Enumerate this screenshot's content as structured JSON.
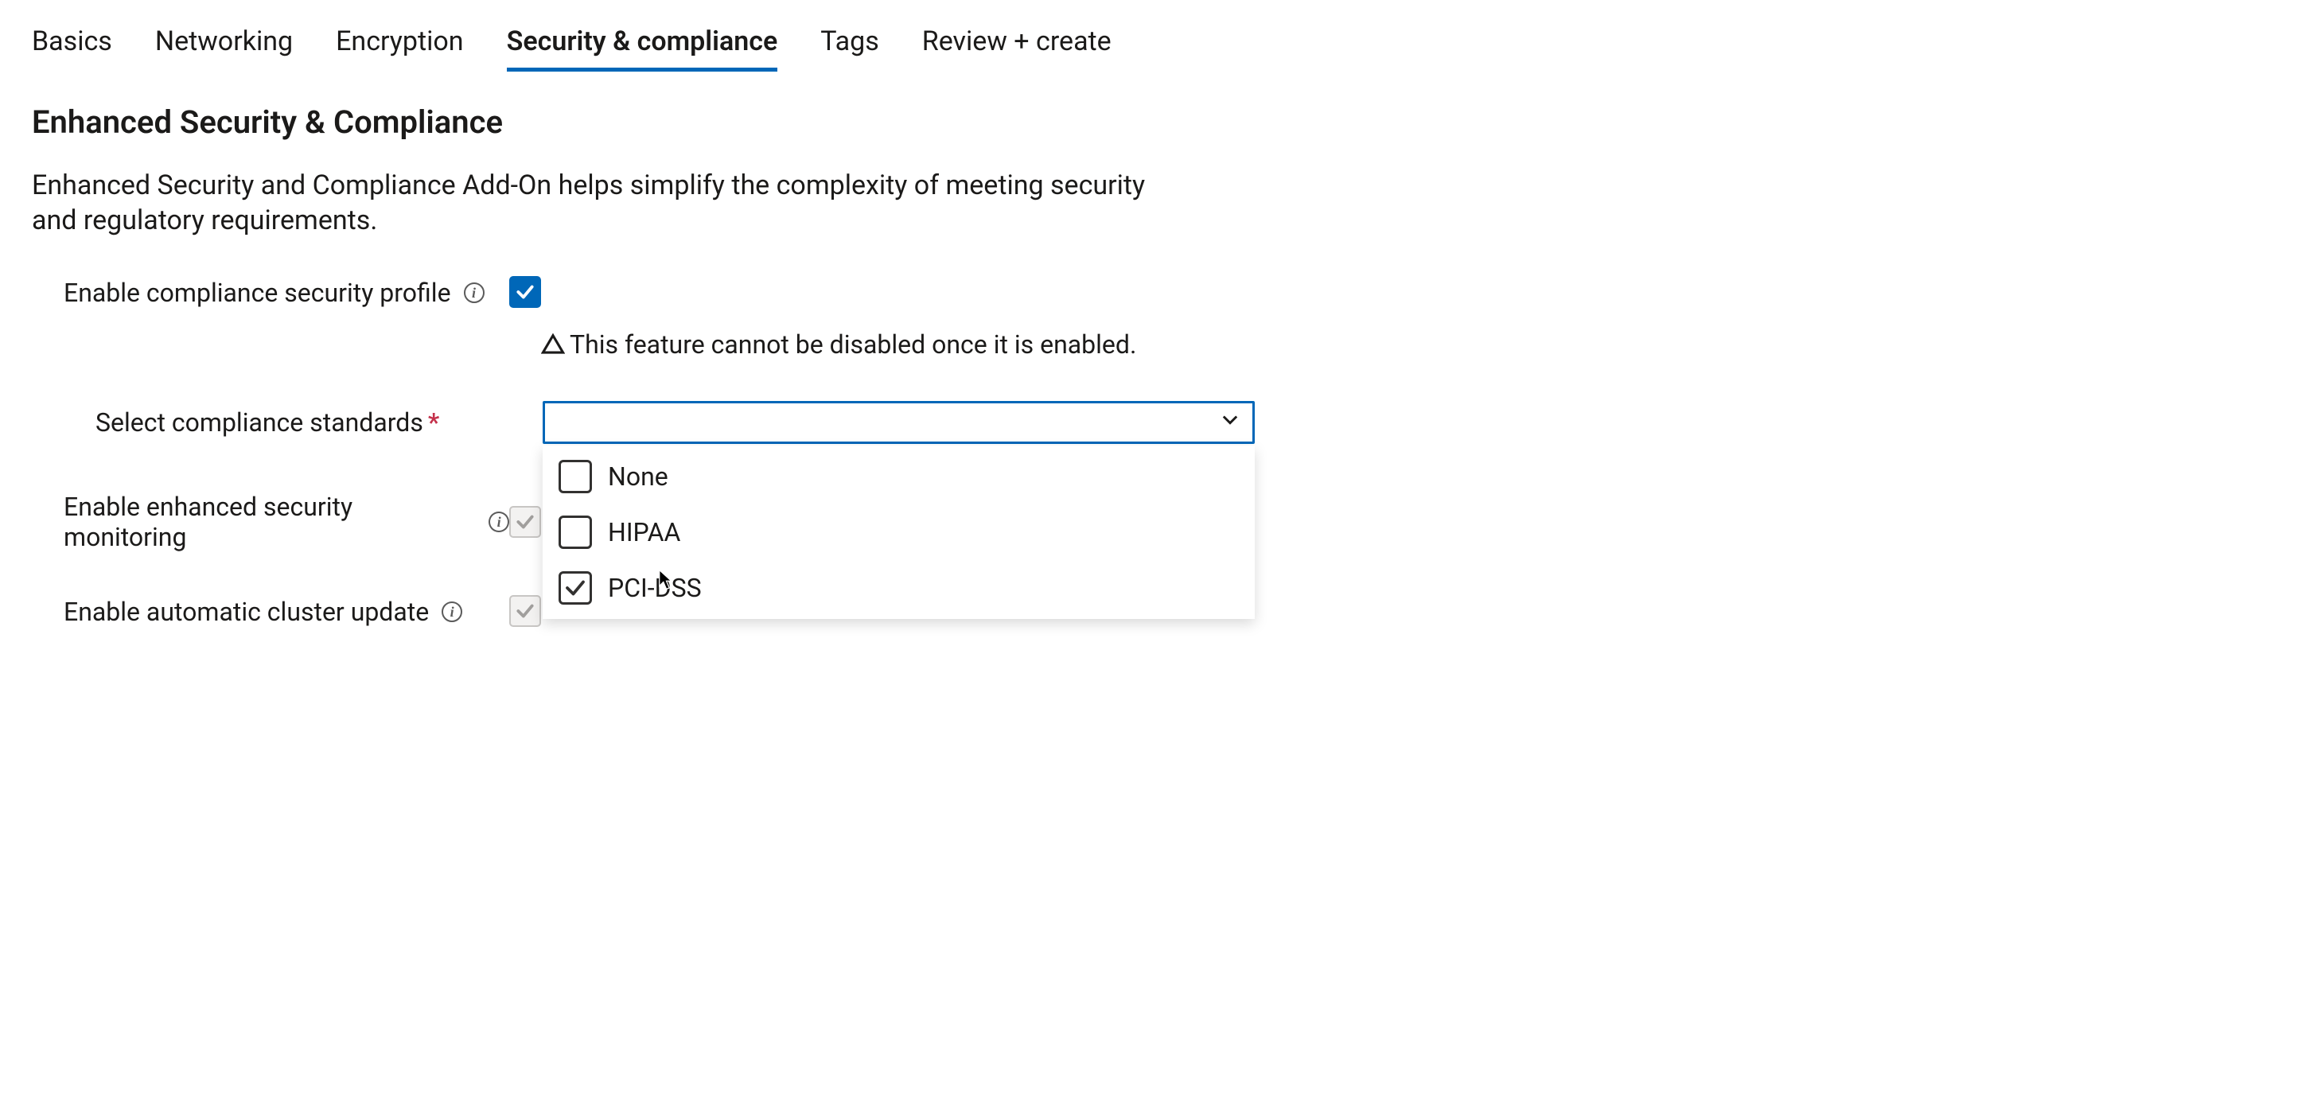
{
  "tabs": {
    "items": [
      {
        "label": "Basics",
        "active": false
      },
      {
        "label": "Networking",
        "active": false
      },
      {
        "label": "Encryption",
        "active": false
      },
      {
        "label": "Security & compliance",
        "active": true
      },
      {
        "label": "Tags",
        "active": false
      },
      {
        "label": "Review + create",
        "active": false
      }
    ]
  },
  "section": {
    "title": "Enhanced Security & Compliance",
    "description": "Enhanced Security and Compliance Add-On helps simplify the complexity of meeting security and regulatory requirements."
  },
  "fields": {
    "enable_profile": {
      "label": "Enable compliance security profile",
      "checked": true,
      "warning": "This feature cannot be disabled once it is enabled."
    },
    "compliance_standards": {
      "label": "Select compliance standards",
      "required": true,
      "value": "",
      "options": [
        {
          "label": "None",
          "checked": false
        },
        {
          "label": "HIPAA",
          "checked": false
        },
        {
          "label": "PCI-DSS",
          "checked": true
        }
      ]
    },
    "enhanced_monitoring": {
      "label": "Enable enhanced security monitoring",
      "checked": true,
      "disabled": true
    },
    "auto_update": {
      "label": "Enable automatic cluster update",
      "checked": true,
      "disabled": true
    }
  },
  "colors": {
    "accent": "#0067b8",
    "required": "#c4314b"
  }
}
